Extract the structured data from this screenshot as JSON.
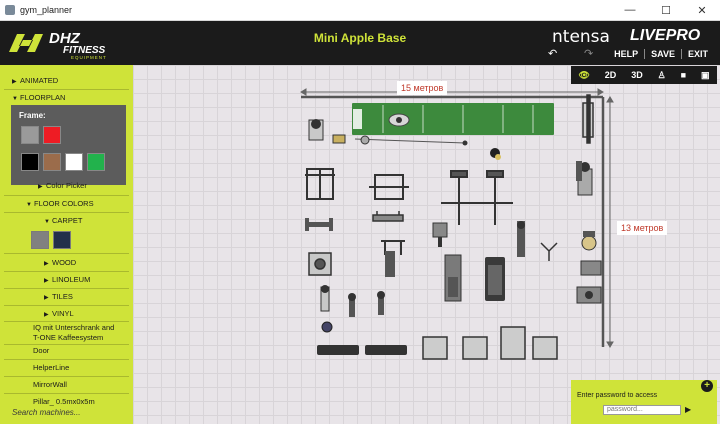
{
  "window": {
    "title": "gym_planner",
    "controls": [
      "—",
      "☐",
      "✕"
    ]
  },
  "header": {
    "logo_main": "DHZ",
    "logo_sub": "FITNESS",
    "logo_tag": "EQUIPMENT",
    "project_title": "Mini Apple Base",
    "brand_intensa": "ntensa",
    "brand_livepro": "LIVEPRO",
    "actions": {
      "help": "HELP",
      "save": "SAVE",
      "exit": "EXIT"
    }
  },
  "viewbar": {
    "eye_icon": "eye-icon",
    "btn_2d": "2D",
    "btn_3d": "3D",
    "person_icon": "person-icon",
    "camera_icon": "camera-icon",
    "screen_icon": "screen-icon"
  },
  "sidebar": {
    "animated": "ANIMATED",
    "floorplan": "FLOORPLAN",
    "frame_label": "Frame:",
    "frame_colors": [
      "#9a9a9a",
      "#ee1c24",
      "#000000",
      "#9b6c4b",
      "#ffffff",
      "#22b24c"
    ],
    "color_picker": "Color Picker",
    "floor_colors": "FLOOR COLORS",
    "carpet": "CARPET",
    "carpet_colors": [
      "#808080",
      "#22304a"
    ],
    "wood": "WOOD",
    "linoleum": "LINOLEUM",
    "tiles": "TILES",
    "vinyl": "VINYL",
    "item_iq_1": "IQ mit Unterschrank and",
    "item_iq_2": "T-ONE Kaffeesystem",
    "door": "Door",
    "helperline": "HelperLine",
    "mirrorwall": "MirrorWall",
    "pillar": "Pillar_ 0.5mx0x5m",
    "search_placeholder": "Search machines..."
  },
  "canvas": {
    "dim_width": "15 метров",
    "dim_depth": "13 метров",
    "turf_color": "#3d8a3d",
    "accent_color": "#cfe339"
  },
  "password": {
    "label": "Enter password to access",
    "placeholder": "password..."
  }
}
